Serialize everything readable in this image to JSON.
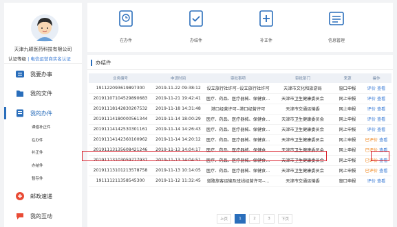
{
  "sidebar": {
    "company": "天津九颖医药科技有限公司",
    "cert_label": "认证等级",
    "cert_link": "电信运营商实名认证",
    "nav": [
      {
        "label": "我要办事"
      },
      {
        "label": "我的文件"
      },
      {
        "label": "我的办件"
      },
      {
        "label": "邮政速递"
      },
      {
        "label": "我的互动"
      }
    ],
    "sub_items": [
      "课借补正件",
      "在办件",
      "补正件",
      "办结件",
      "暂存件"
    ]
  },
  "cards": [
    {
      "label": "在办件",
      "icon": "pending-doc-icon"
    },
    {
      "label": "办结件",
      "icon": "done-doc-icon"
    },
    {
      "label": "补正件",
      "icon": "supplement-doc-icon"
    },
    {
      "label": "信息管理",
      "icon": "info-manage-icon"
    }
  ],
  "panel": {
    "title": "办结件",
    "headers": [
      "业务编号",
      "申请时间",
      "审批事项",
      "审批部门",
      "来源",
      "操作"
    ],
    "rows": [
      {
        "id": "191122093619897300",
        "time": "2019-11-22 09:38:12",
        "item": "设立旅行社许可--设立旅行社许可",
        "dept": "天津市文化和旅游局",
        "src": "窗口申报",
        "op1": "评价",
        "op2": "查看",
        "done": false
      },
      {
        "id": "20191107104529890683",
        "time": "2019-11-21 19:42:41",
        "item": "医疗、药品、医疗器械、保健食...",
        "dept": "天津市卫生健康委员会",
        "src": "网上申报",
        "op1": "评价",
        "op2": "查看",
        "done": false
      },
      {
        "id": "20191118142830207532",
        "time": "2019-11-18 14:31:48",
        "item": "港口经营许可--港口经营许可",
        "dept": "天津市交通运输委",
        "src": "网上申报",
        "op1": "评价",
        "op2": "查看",
        "done": false
      },
      {
        "id": "20191114180000561344",
        "time": "2019-11-14 18:00:29",
        "item": "医疗、药品、医疗器械、保健食...",
        "dept": "天津市卫生健康委员会",
        "src": "网上申报",
        "op1": "评价",
        "op2": "查看",
        "done": false
      },
      {
        "id": "20191114142530301161",
        "time": "2019-11-14 14:26:43",
        "item": "医疗、药品、医疗器械、保健食...",
        "dept": "天津市卫生健康委员会",
        "src": "网上申报",
        "op1": "评价",
        "op2": "查看",
        "done": false
      },
      {
        "id": "20191114142360100962",
        "time": "2019-11-14 14:20:12",
        "item": "医疗、药品、医疗器械、保健食...",
        "dept": "天津市卫生健康委员会",
        "src": "网上申报",
        "op1": "已评价",
        "op2": "查看",
        "done": true
      },
      {
        "id": "20191113135608421246",
        "time": "2019-11-13 14:04:17",
        "item": "医疗、药品、医疗器械、保健食...",
        "dept": "天津市卫生健康委员会",
        "src": "网上申报",
        "op1": "已评价",
        "op2": "查看",
        "done": true
      },
      {
        "id": "20191113103059777937",
        "time": "2019-11-13 14:04:51",
        "item": "医疗、药品、医疗器械、保健食...",
        "dept": "天津市卫生健康委员会",
        "src": "网上申报",
        "op1": "已评价",
        "op2": "查看",
        "done": true
      },
      {
        "id": "20191113101213578758",
        "time": "2019-11-13 10:14:05",
        "item": "医疗、药品、医疗器械、保健食...",
        "dept": "天津市卫生健康委员会",
        "src": "网上申报",
        "op1": "已评价",
        "op2": "查看",
        "done": true
      },
      {
        "id": "191111211358545300",
        "time": "2019-11-12 11:32:45",
        "item": "道路旅客运输及班线经营许可--...",
        "dept": "天津市交通运输委",
        "src": "窗口申报",
        "op1": "评价",
        "op2": "查看",
        "done": false
      }
    ]
  },
  "pager": {
    "prev": "上页",
    "pages": [
      "1",
      "2",
      "3"
    ],
    "next": "下页",
    "current": "1"
  },
  "colors": {
    "accent": "#2a6ebb",
    "highlight": "#d9202c",
    "done": "#f08a24"
  }
}
